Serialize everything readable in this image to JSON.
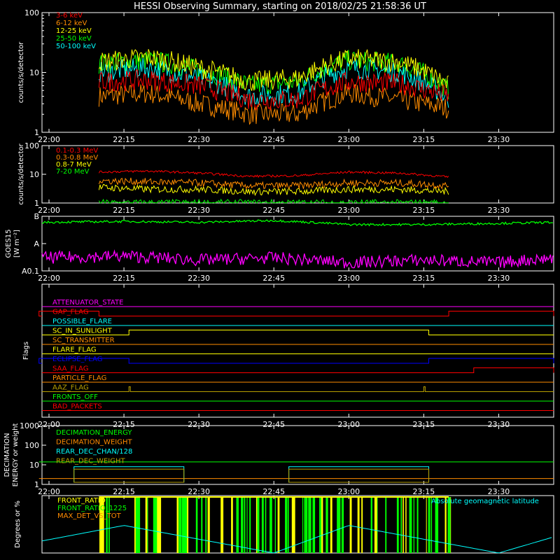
{
  "title": "HESSI Observing Summary, starting on 2018/02/25 21:58:36 UT",
  "time_ticks": [
    "22:00",
    "22:15",
    "22:30",
    "22:45",
    "23:00",
    "23:15",
    "23:30"
  ],
  "colors": {
    "background": "#000000",
    "axes": "#ffffff",
    "red": "#ff0000",
    "orange": "#ff8c00",
    "yellow": "#ffff00",
    "green": "#00ff00",
    "cyan": "#00ffff",
    "magenta": "#ff00ff",
    "blue": "#0000ff",
    "olive": "#b8a000",
    "pink": "#ff6aa0"
  },
  "chart_data": [
    {
      "id": "low_energy_rates",
      "type": "line",
      "ylabel": "counts/s/detector",
      "yscale": "log",
      "ylim": [
        1,
        100
      ],
      "y_ticks": [
        "100",
        "10",
        "1"
      ],
      "xlim": [
        "21:58",
        "23:41"
      ],
      "data_start": "22:10",
      "data_end": "23:20",
      "legend_position": "top-left",
      "series": [
        {
          "name": "3-6 keV",
          "color": "#ff0000",
          "x": [
            "22:10",
            "22:20",
            "22:30",
            "22:40",
            "22:50",
            "23:00",
            "23:10",
            "23:20"
          ],
          "values": [
            7,
            7.5,
            6,
            3.5,
            3.5,
            7,
            6.5,
            4
          ]
        },
        {
          "name": "6-12 keV",
          "color": "#ff8c00",
          "x": [
            "22:10",
            "22:20",
            "22:30",
            "22:40",
            "22:50",
            "23:00",
            "23:10",
            "23:20"
          ],
          "values": [
            4,
            4.5,
            3,
            2,
            2,
            4.5,
            3.5,
            2.5
          ]
        },
        {
          "name": "12-25 keV",
          "color": "#ffff00",
          "x": [
            "22:10",
            "22:20",
            "22:30",
            "22:40",
            "22:50",
            "23:00",
            "23:10",
            "23:20"
          ],
          "values": [
            15,
            18,
            12,
            7,
            8,
            17,
            15,
            6
          ]
        },
        {
          "name": "25-50 keV",
          "color": "#00ff00",
          "x": [
            "22:10",
            "22:20",
            "22:30",
            "22:40",
            "22:50",
            "23:00",
            "23:10",
            "23:20"
          ],
          "values": [
            14,
            16,
            11,
            6,
            7,
            16,
            14,
            5
          ]
        },
        {
          "name": "50-100 keV",
          "color": "#00ffff",
          "x": [
            "22:10",
            "22:20",
            "22:30",
            "22:40",
            "22:50",
            "23:00",
            "23:10",
            "23:20"
          ],
          "values": [
            10,
            12,
            8,
            4,
            4.5,
            12,
            10,
            3.5
          ]
        }
      ]
    },
    {
      "id": "high_energy_rates",
      "type": "line",
      "ylabel": "counts/s/detector",
      "yscale": "log",
      "ylim": [
        1,
        100
      ],
      "y_ticks": [
        "100",
        "10",
        "1"
      ],
      "legend_position": "top-left",
      "series": [
        {
          "name": "0.1-0.3 MeV",
          "color": "#ff0000",
          "x": [
            "22:10",
            "22:20",
            "22:30",
            "22:40",
            "22:50",
            "23:00",
            "23:10",
            "23:20"
          ],
          "values": [
            12,
            13,
            11,
            8.5,
            9,
            12,
            11,
            8
          ]
        },
        {
          "name": "0.3-0.8 MeV",
          "color": "#ff8c00",
          "x": [
            "22:10",
            "22:20",
            "22:30",
            "22:40",
            "22:50",
            "23:00",
            "23:10",
            "23:20"
          ],
          "values": [
            6,
            5.5,
            5,
            4,
            4,
            5,
            5,
            4
          ]
        },
        {
          "name": "0.8-7 MeV",
          "color": "#ffff00",
          "x": [
            "22:10",
            "22:20",
            "22:30",
            "22:40",
            "22:50",
            "23:00",
            "23:10",
            "23:20"
          ],
          "values": [
            3.5,
            3,
            3,
            2.5,
            2.5,
            3,
            3,
            2.5
          ]
        },
        {
          "name": "7-20 MeV",
          "color": "#00ff00",
          "x": [
            "22:10",
            "23:20"
          ],
          "values": [
            1,
            1
          ]
        }
      ]
    },
    {
      "id": "goes",
      "type": "line",
      "ylabel": "GOES15",
      "ylabel2": "[W m⁻²]",
      "yscale": "log",
      "y_ticks": [
        "B",
        "A",
        "A0.1"
      ],
      "series": [
        {
          "color": "#00ff00",
          "x": [
            "21:58",
            "22:15",
            "22:30",
            "22:45",
            "23:00",
            "23:15",
            "23:30",
            "23:41"
          ],
          "values": [
            "A6",
            "A6.5",
            "A6",
            "A7",
            "A5",
            "A5",
            "A5.5",
            "A6"
          ]
        },
        {
          "color": "#ff00ff",
          "x": [
            "21:58",
            "22:15",
            "22:30",
            "22:45",
            "23:00",
            "23:15",
            "23:30",
            "23:41"
          ],
          "values": [
            "A0.3",
            "A0.35",
            "A0.25",
            "A0.3",
            "A0.2",
            "A0.25",
            "A0.2",
            "A0.3"
          ]
        }
      ]
    },
    {
      "id": "flags",
      "type": "line",
      "ylabel": "Flags",
      "series": [
        {
          "name": "ATTENUATOR_STATE",
          "color": "#ff00ff",
          "high": []
        },
        {
          "name": "GAP_FLAG",
          "color": "#ff0000",
          "high": [
            [
              "21:58",
              "22:10"
            ],
            [
              "23:20",
              "23:41"
            ]
          ]
        },
        {
          "name": "POSSIBLE_FLARE",
          "color": "#00ffff",
          "high": []
        },
        {
          "name": "SC_IN_SUNLIGHT",
          "color": "#ffff00",
          "high": [
            [
              "22:16",
              "23:16"
            ]
          ]
        },
        {
          "name": "SC_TRANSMITTER",
          "color": "#ff8c00",
          "high": []
        },
        {
          "name": "FLARE_FLAG",
          "color": "#ffff00",
          "high": []
        },
        {
          "name": "ECLIPSE_FLAG",
          "color": "#0000ff",
          "high": [
            [
              "21:58",
              "22:16"
            ],
            [
              "23:16",
              "23:41"
            ]
          ]
        },
        {
          "name": "SAA_FLAG",
          "color": "#ff0000",
          "high": [
            [
              "23:25",
              "23:41"
            ]
          ]
        },
        {
          "name": "PARTICLE_FLAG",
          "color": "#ff8c00",
          "high": []
        },
        {
          "name": "AAZ_FLAG",
          "color": "#b8a000",
          "high": [
            [
              "22:16",
              "22:16"
            ],
            [
              "23:15",
              "23:15"
            ]
          ]
        },
        {
          "name": "FRONTS_OFF",
          "color": "#00ff00",
          "high": []
        },
        {
          "name": "BAD_PACKETS",
          "color": "#ff0000",
          "high": []
        }
      ]
    },
    {
      "id": "decimation",
      "type": "line",
      "ylabel": "DECIMATION",
      "ylabel2": "ENERGY or weight",
      "yscale": "log",
      "ylim": [
        1,
        1000
      ],
      "y_ticks": [
        "1000",
        "100",
        "10",
        "1"
      ],
      "series": [
        {
          "name": "DECIMATION_ENERGY",
          "color": "#00ff00",
          "x": [
            "21:58",
            "23:41"
          ],
          "values": [
            14,
            14
          ]
        },
        {
          "name": "DECIMATION_WEIGHT",
          "color": "#ff8c00",
          "x": [
            "21:58",
            "23:41"
          ],
          "values": [
            2,
            2
          ]
        },
        {
          "name": "REAR_DEC_CHAN/128",
          "color": "#00ffff",
          "x": [
            "22:05",
            "22:27",
            "22:48",
            "23:16"
          ],
          "values": [
            8,
            8,
            8,
            8
          ]
        },
        {
          "name": "REAR_DEC_WEIGHT",
          "color": "#b8a000",
          "x": [
            "22:05",
            "22:27",
            "22:48",
            "23:16"
          ],
          "values": [
            6,
            6,
            6,
            6
          ]
        }
      ]
    },
    {
      "id": "ratios",
      "type": "line",
      "ylabel": "Degrees or %",
      "series": [
        {
          "name": "FRONT_RATIO",
          "color": "#ffff00"
        },
        {
          "name": "FRONT_RATIO_1225",
          "color": "#00ff00"
        },
        {
          "name": "MAX_DET_VS_TOT",
          "color": "#ff8c00"
        },
        {
          "name": "Absolute geomagnetic latitude",
          "color": "#00ffff",
          "x": [
            "21:58",
            "22:15",
            "22:45",
            "23:00",
            "23:30",
            "23:41"
          ],
          "values": [
            20,
            48,
            0,
            48,
            0,
            28
          ]
        }
      ]
    }
  ]
}
